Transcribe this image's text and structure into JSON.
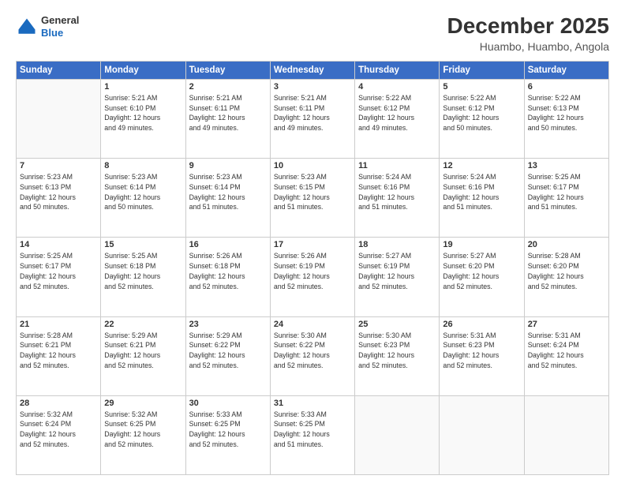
{
  "header": {
    "logo_general": "General",
    "logo_blue": "Blue",
    "title": "December 2025",
    "location": "Huambo, Huambo, Angola"
  },
  "days_of_week": [
    "Sunday",
    "Monday",
    "Tuesday",
    "Wednesday",
    "Thursday",
    "Friday",
    "Saturday"
  ],
  "weeks": [
    [
      {
        "day": "",
        "info": ""
      },
      {
        "day": "1",
        "info": "Sunrise: 5:21 AM\nSunset: 6:10 PM\nDaylight: 12 hours\nand 49 minutes."
      },
      {
        "day": "2",
        "info": "Sunrise: 5:21 AM\nSunset: 6:11 PM\nDaylight: 12 hours\nand 49 minutes."
      },
      {
        "day": "3",
        "info": "Sunrise: 5:21 AM\nSunset: 6:11 PM\nDaylight: 12 hours\nand 49 minutes."
      },
      {
        "day": "4",
        "info": "Sunrise: 5:22 AM\nSunset: 6:12 PM\nDaylight: 12 hours\nand 49 minutes."
      },
      {
        "day": "5",
        "info": "Sunrise: 5:22 AM\nSunset: 6:12 PM\nDaylight: 12 hours\nand 50 minutes."
      },
      {
        "day": "6",
        "info": "Sunrise: 5:22 AM\nSunset: 6:13 PM\nDaylight: 12 hours\nand 50 minutes."
      }
    ],
    [
      {
        "day": "7",
        "info": "Sunrise: 5:23 AM\nSunset: 6:13 PM\nDaylight: 12 hours\nand 50 minutes."
      },
      {
        "day": "8",
        "info": "Sunrise: 5:23 AM\nSunset: 6:14 PM\nDaylight: 12 hours\nand 50 minutes."
      },
      {
        "day": "9",
        "info": "Sunrise: 5:23 AM\nSunset: 6:14 PM\nDaylight: 12 hours\nand 51 minutes."
      },
      {
        "day": "10",
        "info": "Sunrise: 5:23 AM\nSunset: 6:15 PM\nDaylight: 12 hours\nand 51 minutes."
      },
      {
        "day": "11",
        "info": "Sunrise: 5:24 AM\nSunset: 6:16 PM\nDaylight: 12 hours\nand 51 minutes."
      },
      {
        "day": "12",
        "info": "Sunrise: 5:24 AM\nSunset: 6:16 PM\nDaylight: 12 hours\nand 51 minutes."
      },
      {
        "day": "13",
        "info": "Sunrise: 5:25 AM\nSunset: 6:17 PM\nDaylight: 12 hours\nand 51 minutes."
      }
    ],
    [
      {
        "day": "14",
        "info": "Sunrise: 5:25 AM\nSunset: 6:17 PM\nDaylight: 12 hours\nand 52 minutes."
      },
      {
        "day": "15",
        "info": "Sunrise: 5:25 AM\nSunset: 6:18 PM\nDaylight: 12 hours\nand 52 minutes."
      },
      {
        "day": "16",
        "info": "Sunrise: 5:26 AM\nSunset: 6:18 PM\nDaylight: 12 hours\nand 52 minutes."
      },
      {
        "day": "17",
        "info": "Sunrise: 5:26 AM\nSunset: 6:19 PM\nDaylight: 12 hours\nand 52 minutes."
      },
      {
        "day": "18",
        "info": "Sunrise: 5:27 AM\nSunset: 6:19 PM\nDaylight: 12 hours\nand 52 minutes."
      },
      {
        "day": "19",
        "info": "Sunrise: 5:27 AM\nSunset: 6:20 PM\nDaylight: 12 hours\nand 52 minutes."
      },
      {
        "day": "20",
        "info": "Sunrise: 5:28 AM\nSunset: 6:20 PM\nDaylight: 12 hours\nand 52 minutes."
      }
    ],
    [
      {
        "day": "21",
        "info": "Sunrise: 5:28 AM\nSunset: 6:21 PM\nDaylight: 12 hours\nand 52 minutes."
      },
      {
        "day": "22",
        "info": "Sunrise: 5:29 AM\nSunset: 6:21 PM\nDaylight: 12 hours\nand 52 minutes."
      },
      {
        "day": "23",
        "info": "Sunrise: 5:29 AM\nSunset: 6:22 PM\nDaylight: 12 hours\nand 52 minutes."
      },
      {
        "day": "24",
        "info": "Sunrise: 5:30 AM\nSunset: 6:22 PM\nDaylight: 12 hours\nand 52 minutes."
      },
      {
        "day": "25",
        "info": "Sunrise: 5:30 AM\nSunset: 6:23 PM\nDaylight: 12 hours\nand 52 minutes."
      },
      {
        "day": "26",
        "info": "Sunrise: 5:31 AM\nSunset: 6:23 PM\nDaylight: 12 hours\nand 52 minutes."
      },
      {
        "day": "27",
        "info": "Sunrise: 5:31 AM\nSunset: 6:24 PM\nDaylight: 12 hours\nand 52 minutes."
      }
    ],
    [
      {
        "day": "28",
        "info": "Sunrise: 5:32 AM\nSunset: 6:24 PM\nDaylight: 12 hours\nand 52 minutes."
      },
      {
        "day": "29",
        "info": "Sunrise: 5:32 AM\nSunset: 6:25 PM\nDaylight: 12 hours\nand 52 minutes."
      },
      {
        "day": "30",
        "info": "Sunrise: 5:33 AM\nSunset: 6:25 PM\nDaylight: 12 hours\nand 52 minutes."
      },
      {
        "day": "31",
        "info": "Sunrise: 5:33 AM\nSunset: 6:25 PM\nDaylight: 12 hours\nand 51 minutes."
      },
      {
        "day": "",
        "info": ""
      },
      {
        "day": "",
        "info": ""
      },
      {
        "day": "",
        "info": ""
      }
    ]
  ]
}
